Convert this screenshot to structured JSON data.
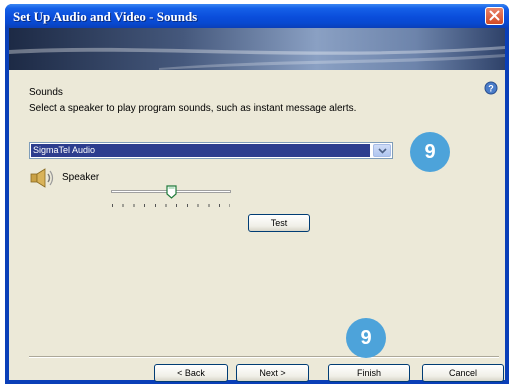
{
  "window": {
    "title": "Set Up Audio and Video - Sounds"
  },
  "content": {
    "section_title": "Sounds",
    "instruction": "Select a speaker to play program sounds, such as instant message alerts.",
    "speaker_select": {
      "value": "SigmaTel Audio"
    },
    "speaker_label": "Speaker",
    "volume_level_fraction": 0.5,
    "test_button": "Test"
  },
  "badges": {
    "top": "9",
    "bottom": "9"
  },
  "footer": {
    "back": "< Back",
    "next": "Next >",
    "finish": "Finish",
    "cancel": "Cancel"
  },
  "icons": {
    "close": "close-icon",
    "help": "help-icon",
    "speaker": "speaker-icon",
    "dropdown": "chevron-down-icon"
  },
  "colors": {
    "titlebar": "#0a4ddb",
    "dialog_bg": "#ece9d8",
    "selection": "#2c3d8e",
    "badge": "#4da3da",
    "close_button": "#d24a25"
  }
}
